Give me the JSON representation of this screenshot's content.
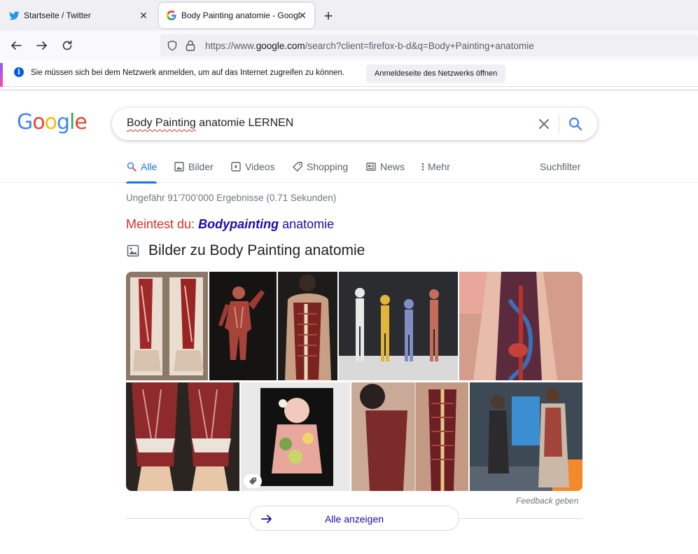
{
  "browser": {
    "tabs": [
      {
        "title": "Startseite / Twitter",
        "icon": "twitter-icon"
      },
      {
        "title": "Body Painting anatomie - Google Suche",
        "icon": "google-g-icon"
      }
    ],
    "url_prefix": "https://www.",
    "url_domain": "google.com",
    "url_rest": "/search?client=firefox-b-d&q=Body+Painting+anatomie",
    "notification": {
      "message": "Sie müssen sich bei dem Netzwerk anmelden, um auf das Internet zugreifen zu können.",
      "button": "Anmeldeseite des Netzwerks öffnen"
    }
  },
  "google": {
    "logo_letters": [
      "G",
      "o",
      "o",
      "g",
      "l",
      "e"
    ],
    "query_main": "Body Painting anatomie",
    "query_underlined": "Body Painting",
    "query_rest": " anatomie LERNEN",
    "tabs": [
      {
        "label": "Alle",
        "icon": "search-icon",
        "active": true
      },
      {
        "label": "Bilder",
        "icon": "image-icon"
      },
      {
        "label": "Videos",
        "icon": "play-icon"
      },
      {
        "label": "Shopping",
        "icon": "tag-icon"
      },
      {
        "label": "News",
        "icon": "news-icon"
      },
      {
        "label": "Mehr",
        "icon": "more-vert-icon"
      }
    ],
    "filter_label": "Suchfilter",
    "stats": "Ungefähr 91’700’000 Ergebnisse (0.71 Sekunden)",
    "did_you_mean_label": "Meintest du:",
    "did_you_mean_bold": "Bodypainting",
    "did_you_mean_rest": " anatomie",
    "images_heading": "Bilder zu Body Painting anatomie",
    "feedback": "Feedback geben",
    "show_all": "Alle anzeigen"
  },
  "colors": {
    "google_blue": "#4285F4",
    "google_red": "#EA4335",
    "google_yellow": "#FBBC05",
    "google_green": "#34A853",
    "link": "#1a0dab",
    "active_tab": "#1a73e8"
  }
}
